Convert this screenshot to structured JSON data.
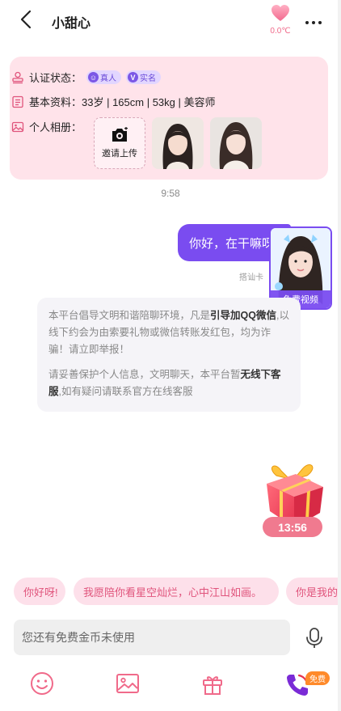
{
  "header": {
    "title": "小甜心",
    "temperature": "0.0℃"
  },
  "profile": {
    "cert_label": "认证状态：",
    "badges": [
      "真人",
      "实名"
    ],
    "info_label": "基本资料：",
    "info_value": "33岁 | 165cm | 53kg | 美容师",
    "album_label": "个人相册：",
    "upload_label": "邀请上传"
  },
  "chat": {
    "time": "9:58",
    "message": "你好，在干嘛呀",
    "note": "搭讪卡",
    "video_label": "免费视频"
  },
  "notice": {
    "p1_a": "本平台倡导文明和谐陪聊环境，凡是",
    "p1_b": "引导加QQ微信",
    "p1_c": ",以线下约会为由索要礼物或微信转账发红包，均为诈骗！请立即举报！",
    "p2_a": "请妥善保护个人信息，文明聊天，本平台暂",
    "p2_b": "无线下客服",
    "p2_c": ",如有疑问请联系官方在线客服"
  },
  "gift": {
    "countdown": "13:56"
  },
  "quick_replies": [
    "你好呀!",
    "我愿陪你看星空灿烂，心中江山如画。",
    "你是我的"
  ],
  "input": {
    "placeholder": "您还有免费金币未使用"
  },
  "toolbar": {
    "free_badge": "免费"
  },
  "colors": {
    "accent_purple": "#7a4cf0",
    "accent_pink": "#f06a8a",
    "card_bg": "#ffe3ea"
  }
}
